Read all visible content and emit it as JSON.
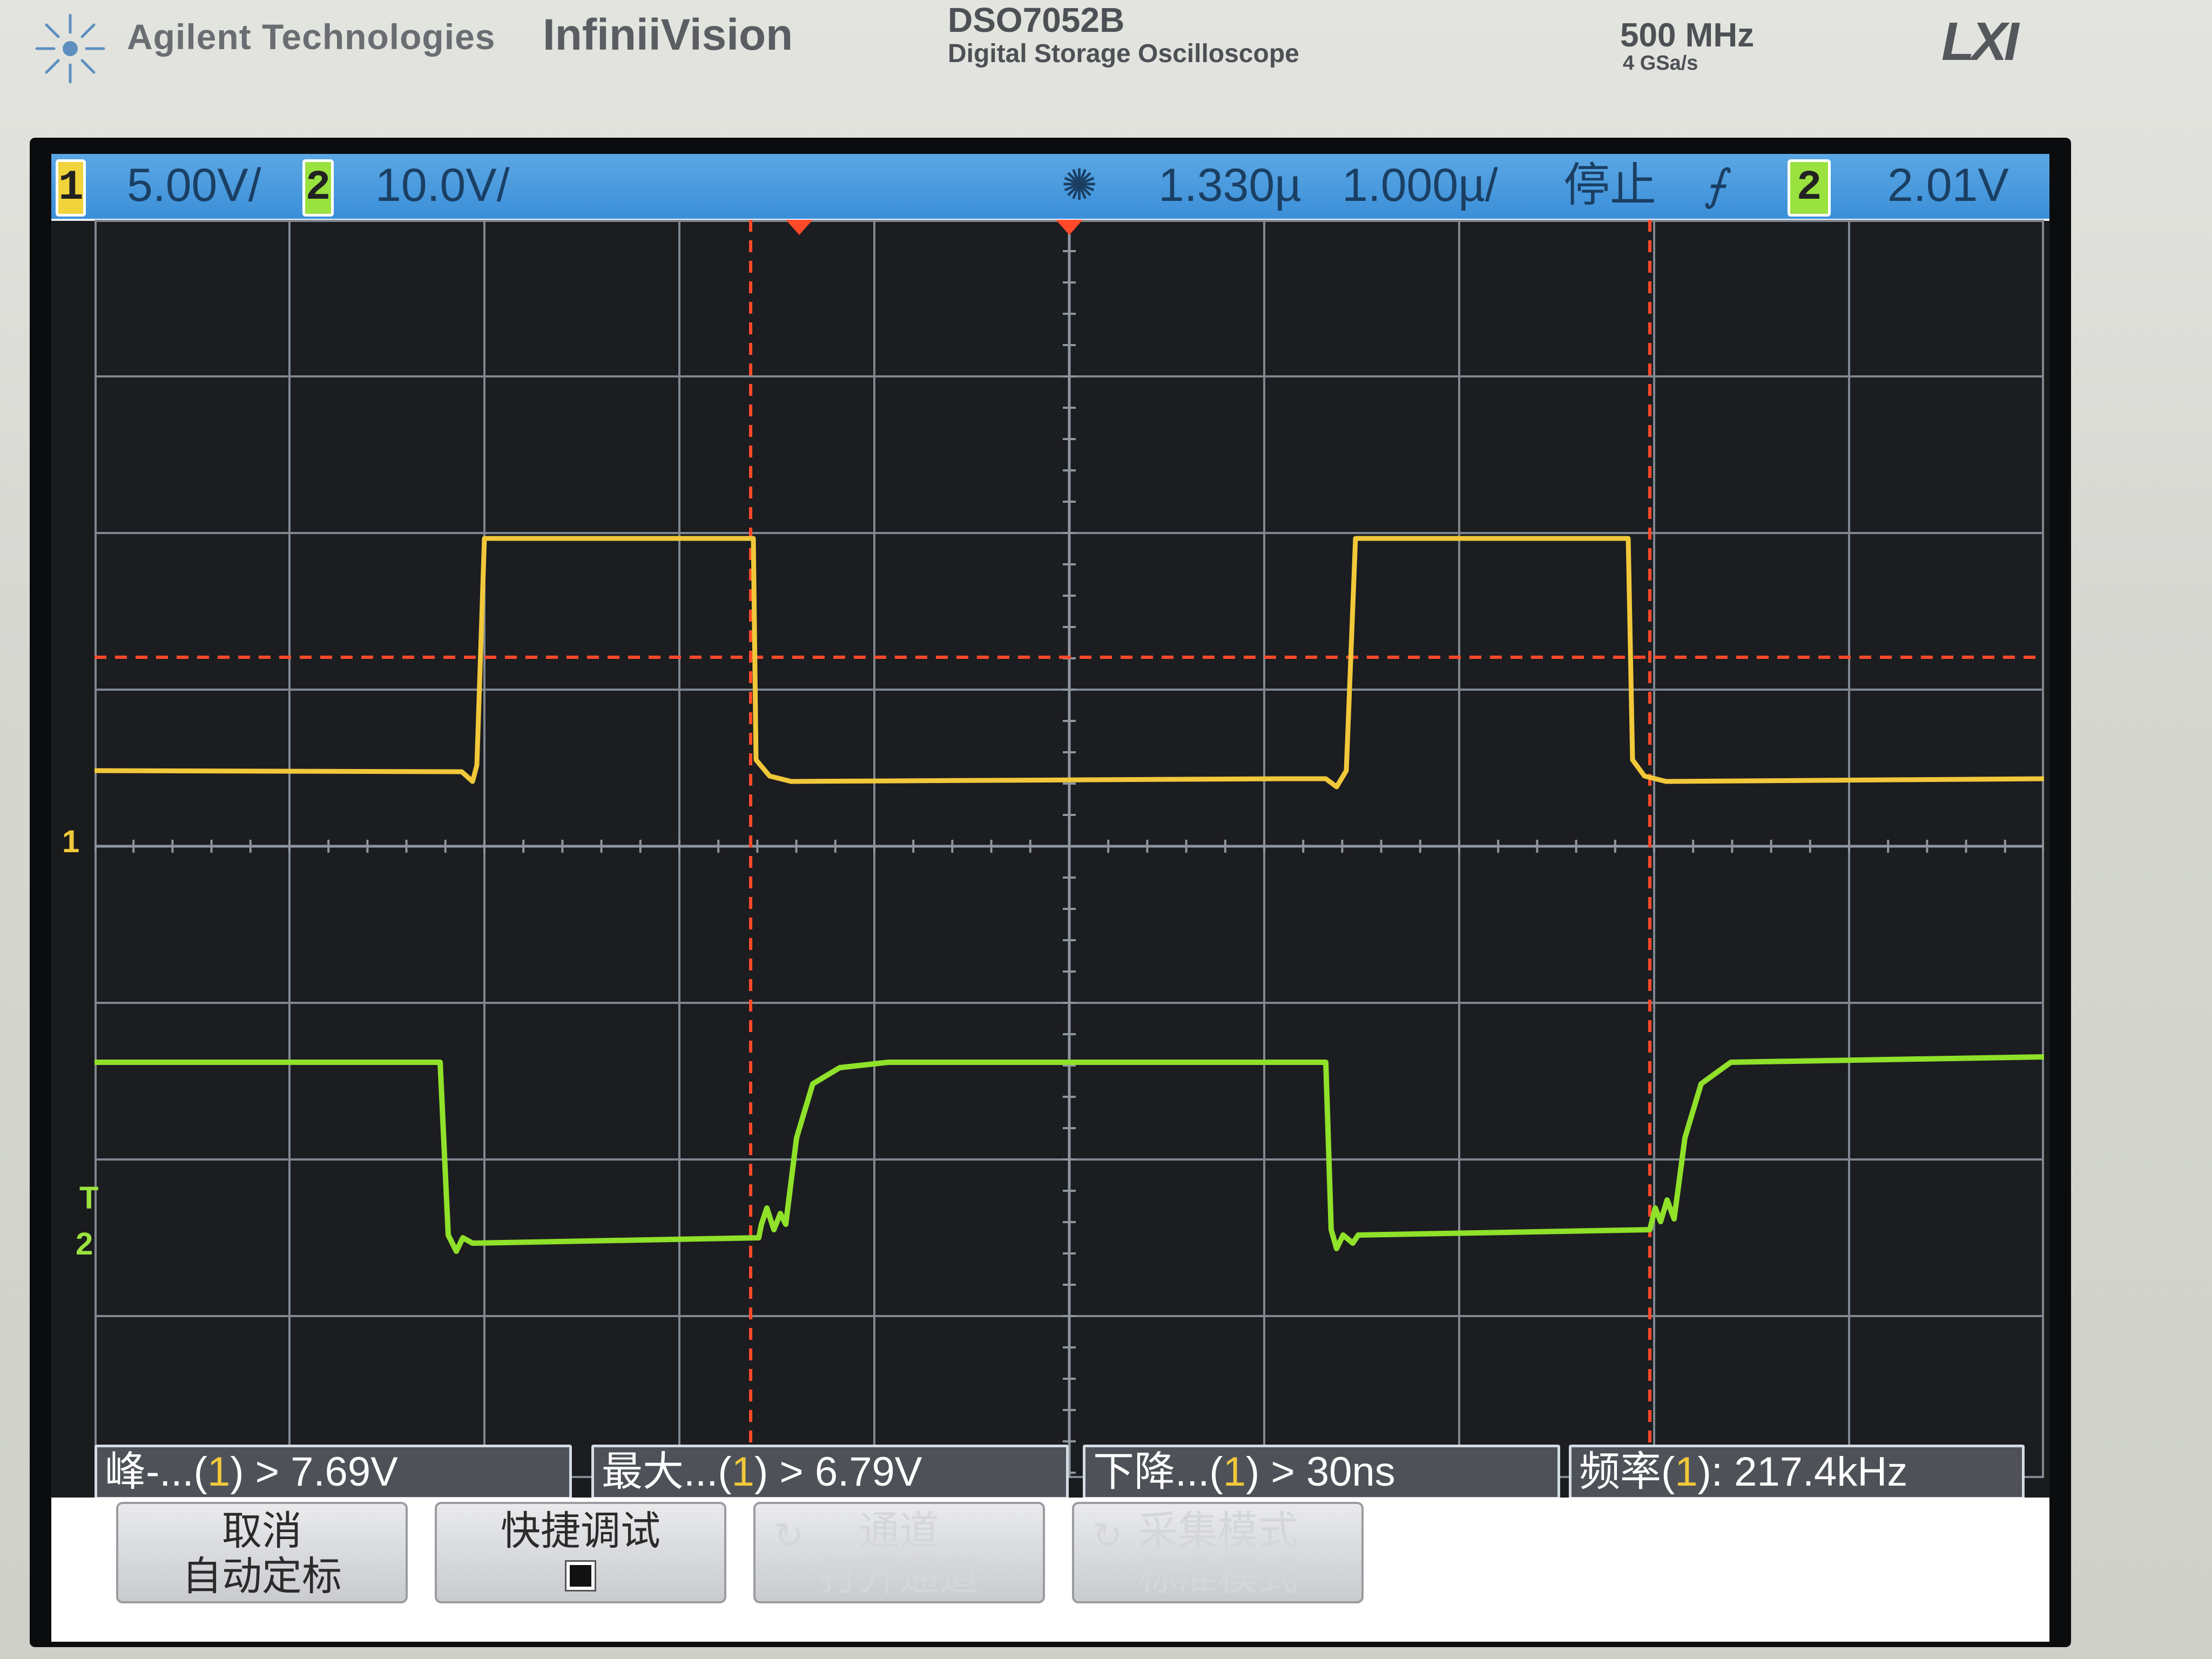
{
  "device": {
    "brand": "Agilent Technologies",
    "series": "InfiniiVision",
    "model": "DSO7052B",
    "description": "Digital Storage Oscilloscope",
    "bandwidth": "500 MHz",
    "sample_rate": "4 GSa/s",
    "lxi_logo": "LXI"
  },
  "status_bar": {
    "ch1": {
      "number": "1",
      "scale": "5.00V/"
    },
    "ch2": {
      "number": "2",
      "scale": "10.0V/"
    },
    "trigger_indicator_icon": "trigger-sun-icon",
    "delay": "1.330µ",
    "timebase": "1.000µ/",
    "run_state": "停止",
    "trigger_edge_icon": "falling-edge-icon",
    "trigger_source": "2",
    "trigger_level": "2.01V"
  },
  "graticule": {
    "markers": {
      "ch1": "1",
      "trigger": "T",
      "ch2": "2"
    }
  },
  "measurements": [
    {
      "name": "峰-...",
      "channel": "1",
      "value": "7.69V"
    },
    {
      "name": "最大...",
      "channel": "1",
      "value": "6.79V"
    },
    {
      "name": "下降...",
      "channel": "1",
      "value": "30ns"
    },
    {
      "name": "频率",
      "channel": "1",
      "value": "217.4kHz"
    }
  ],
  "softkeys": [
    {
      "line1": "取消",
      "line2": "自动定标",
      "enabled": true
    },
    {
      "line1": "快捷调试",
      "line2": "",
      "enabled": true
    },
    {
      "line1": "通道",
      "line2": "打开通道",
      "enabled": false
    },
    {
      "line1": "采集模式",
      "line2": "标准模式",
      "enabled": false
    }
  ],
  "colors": {
    "ch1": "#f1c83a",
    "ch2": "#9ae23f",
    "cursor": "#ff4a2a",
    "status_bar": "#3b8fd8",
    "grid": "#7f8790",
    "screen_bg": "#1a1b1d"
  }
}
